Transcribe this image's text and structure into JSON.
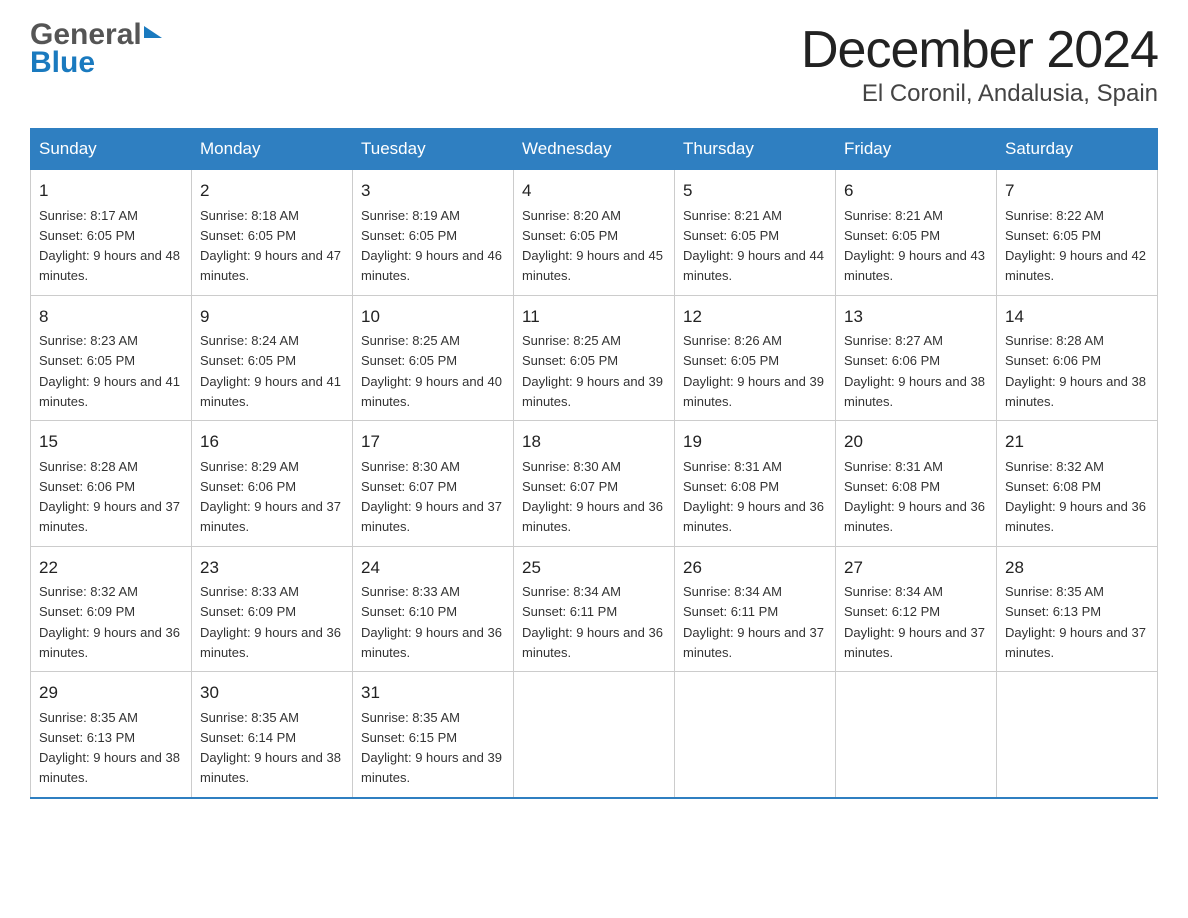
{
  "header": {
    "month_title": "December 2024",
    "location": "El Coronil, Andalusia, Spain",
    "logo_general": "General",
    "logo_blue": "Blue"
  },
  "columns": [
    "Sunday",
    "Monday",
    "Tuesday",
    "Wednesday",
    "Thursday",
    "Friday",
    "Saturday"
  ],
  "weeks": [
    [
      {
        "day": "1",
        "sunrise": "8:17 AM",
        "sunset": "6:05 PM",
        "daylight": "9 hours and 48 minutes."
      },
      {
        "day": "2",
        "sunrise": "8:18 AM",
        "sunset": "6:05 PM",
        "daylight": "9 hours and 47 minutes."
      },
      {
        "day": "3",
        "sunrise": "8:19 AM",
        "sunset": "6:05 PM",
        "daylight": "9 hours and 46 minutes."
      },
      {
        "day": "4",
        "sunrise": "8:20 AM",
        "sunset": "6:05 PM",
        "daylight": "9 hours and 45 minutes."
      },
      {
        "day": "5",
        "sunrise": "8:21 AM",
        "sunset": "6:05 PM",
        "daylight": "9 hours and 44 minutes."
      },
      {
        "day": "6",
        "sunrise": "8:21 AM",
        "sunset": "6:05 PM",
        "daylight": "9 hours and 43 minutes."
      },
      {
        "day": "7",
        "sunrise": "8:22 AM",
        "sunset": "6:05 PM",
        "daylight": "9 hours and 42 minutes."
      }
    ],
    [
      {
        "day": "8",
        "sunrise": "8:23 AM",
        "sunset": "6:05 PM",
        "daylight": "9 hours and 41 minutes."
      },
      {
        "day": "9",
        "sunrise": "8:24 AM",
        "sunset": "6:05 PM",
        "daylight": "9 hours and 41 minutes."
      },
      {
        "day": "10",
        "sunrise": "8:25 AM",
        "sunset": "6:05 PM",
        "daylight": "9 hours and 40 minutes."
      },
      {
        "day": "11",
        "sunrise": "8:25 AM",
        "sunset": "6:05 PM",
        "daylight": "9 hours and 39 minutes."
      },
      {
        "day": "12",
        "sunrise": "8:26 AM",
        "sunset": "6:05 PM",
        "daylight": "9 hours and 39 minutes."
      },
      {
        "day": "13",
        "sunrise": "8:27 AM",
        "sunset": "6:06 PM",
        "daylight": "9 hours and 38 minutes."
      },
      {
        "day": "14",
        "sunrise": "8:28 AM",
        "sunset": "6:06 PM",
        "daylight": "9 hours and 38 minutes."
      }
    ],
    [
      {
        "day": "15",
        "sunrise": "8:28 AM",
        "sunset": "6:06 PM",
        "daylight": "9 hours and 37 minutes."
      },
      {
        "day": "16",
        "sunrise": "8:29 AM",
        "sunset": "6:06 PM",
        "daylight": "9 hours and 37 minutes."
      },
      {
        "day": "17",
        "sunrise": "8:30 AM",
        "sunset": "6:07 PM",
        "daylight": "9 hours and 37 minutes."
      },
      {
        "day": "18",
        "sunrise": "8:30 AM",
        "sunset": "6:07 PM",
        "daylight": "9 hours and 36 minutes."
      },
      {
        "day": "19",
        "sunrise": "8:31 AM",
        "sunset": "6:08 PM",
        "daylight": "9 hours and 36 minutes."
      },
      {
        "day": "20",
        "sunrise": "8:31 AM",
        "sunset": "6:08 PM",
        "daylight": "9 hours and 36 minutes."
      },
      {
        "day": "21",
        "sunrise": "8:32 AM",
        "sunset": "6:08 PM",
        "daylight": "9 hours and 36 minutes."
      }
    ],
    [
      {
        "day": "22",
        "sunrise": "8:32 AM",
        "sunset": "6:09 PM",
        "daylight": "9 hours and 36 minutes."
      },
      {
        "day": "23",
        "sunrise": "8:33 AM",
        "sunset": "6:09 PM",
        "daylight": "9 hours and 36 minutes."
      },
      {
        "day": "24",
        "sunrise": "8:33 AM",
        "sunset": "6:10 PM",
        "daylight": "9 hours and 36 minutes."
      },
      {
        "day": "25",
        "sunrise": "8:34 AM",
        "sunset": "6:11 PM",
        "daylight": "9 hours and 36 minutes."
      },
      {
        "day": "26",
        "sunrise": "8:34 AM",
        "sunset": "6:11 PM",
        "daylight": "9 hours and 37 minutes."
      },
      {
        "day": "27",
        "sunrise": "8:34 AM",
        "sunset": "6:12 PM",
        "daylight": "9 hours and 37 minutes."
      },
      {
        "day": "28",
        "sunrise": "8:35 AM",
        "sunset": "6:13 PM",
        "daylight": "9 hours and 37 minutes."
      }
    ],
    [
      {
        "day": "29",
        "sunrise": "8:35 AM",
        "sunset": "6:13 PM",
        "daylight": "9 hours and 38 minutes."
      },
      {
        "day": "30",
        "sunrise": "8:35 AM",
        "sunset": "6:14 PM",
        "daylight": "9 hours and 38 minutes."
      },
      {
        "day": "31",
        "sunrise": "8:35 AM",
        "sunset": "6:15 PM",
        "daylight": "9 hours and 39 minutes."
      },
      null,
      null,
      null,
      null
    ]
  ]
}
